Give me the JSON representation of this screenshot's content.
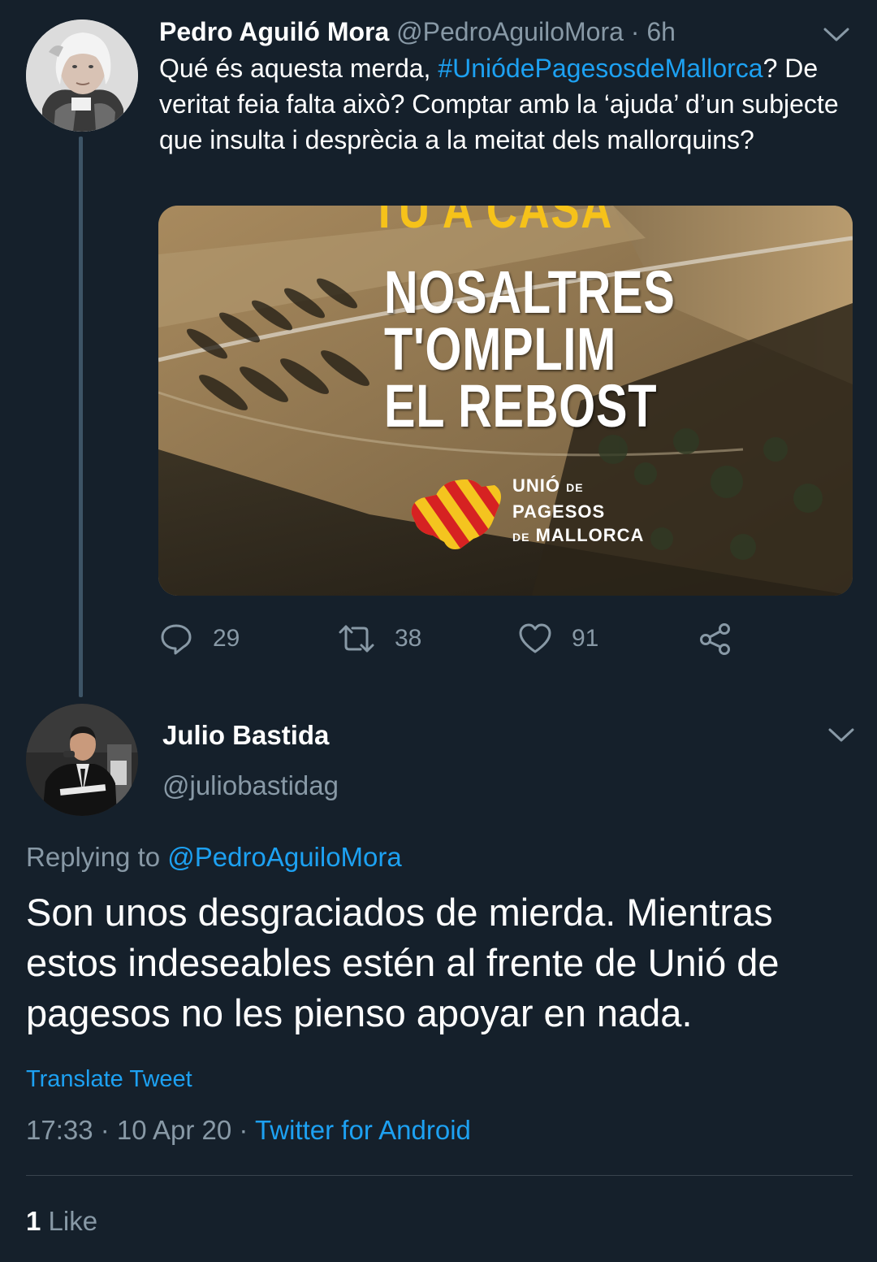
{
  "parent_tweet": {
    "author_name": "Pedro Aguiló Mora",
    "handle": "@PedroAguiloMora",
    "separator": "·",
    "time": "6h",
    "text_before": "Qué és aquesta merda, ",
    "hashtag": "#UniódePagesosdeMallorca",
    "text_after": "? De veritat feia falta això? Comptar amb la ‘ajuda’ d’un subjecte que insulta i desprècia a la meitat dels mallorquins?",
    "media": {
      "top_text": "TU A CASA",
      "headline": [
        "NOSALTRES",
        "T'OMPLIM",
        "EL REBOST"
      ],
      "logo_lines": [
        "UNIÓ",
        "DE",
        "PAGESOS",
        "DE",
        "MALLORCA"
      ]
    },
    "actions": {
      "replies": "29",
      "retweets": "38",
      "likes": "91"
    }
  },
  "reply_tweet": {
    "author_name": "Julio Bastida",
    "handle": "@juliobastidag",
    "replying_label": "Replying to ",
    "replying_handle": "@PedroAguiloMora",
    "text": "Son unos desgraciados de mierda. Mientras estos indeseables estén al frente de Unió de pagesos no les pienso apoyar en nada.",
    "translate_label": "Translate Tweet",
    "timestamp": "17:33 · 10 Apr 20",
    "meta_separator": "·",
    "source": "Twitter for Android",
    "like_count": "1",
    "like_label": "Like"
  },
  "colors": {
    "background": "#15202b",
    "secondary_text": "#8899a6",
    "accent": "#1da1f2",
    "thread_line": "#3d5466",
    "headline_yellow": "#f6c21a"
  },
  "icons": [
    "chevron-down-icon",
    "reply-icon",
    "retweet-icon",
    "like-icon",
    "share-icon"
  ]
}
